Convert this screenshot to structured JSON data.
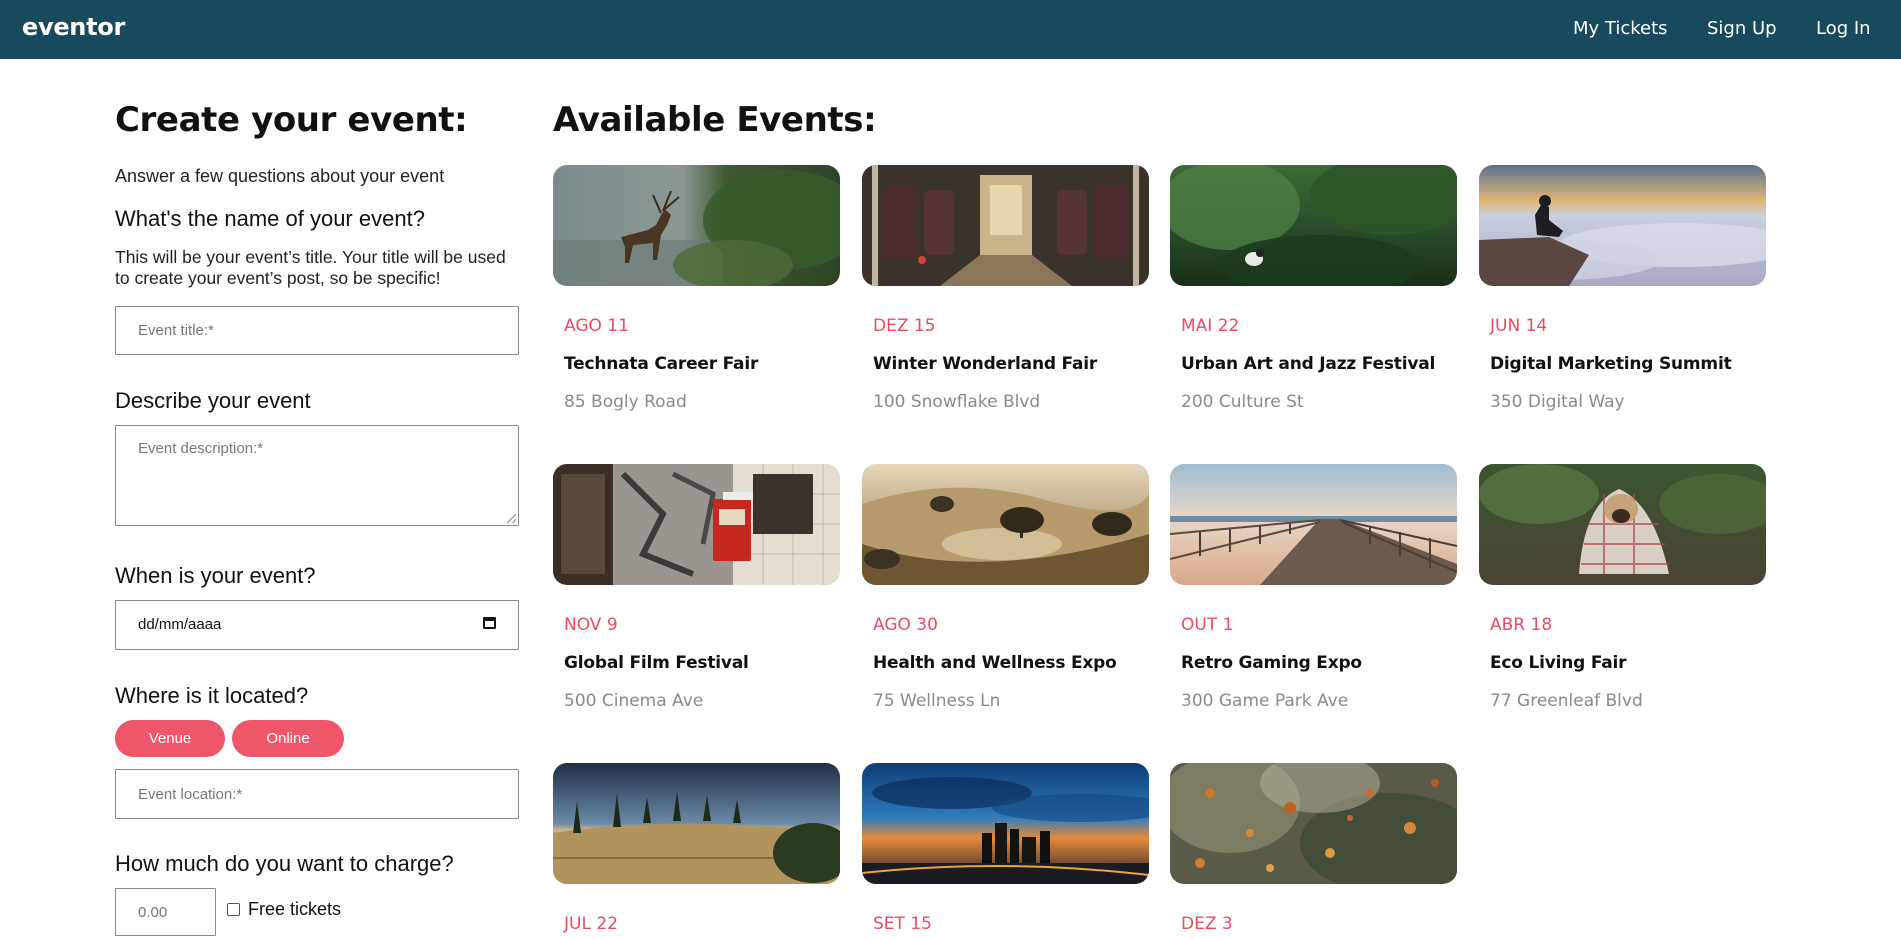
{
  "nav": {
    "brand": "eventor",
    "links": [
      "My Tickets",
      "Sign Up",
      "Log In"
    ]
  },
  "form": {
    "heading": "Create your event:",
    "intro": "Answer a few questions about your event",
    "name_question": "What's the name of your event?",
    "name_help": "This will be your event’s title. Your title will be used to create your event’s post, so be specific!",
    "title_placeholder": "Event title:*",
    "describe_question": "Describe your event",
    "description_placeholder": "Event description:*",
    "when_question": "When is your event?",
    "date_value": "dd/mm/aaaa",
    "where_question": "Where is it located?",
    "venue_label": "Venue",
    "online_label": "Online",
    "location_placeholder": "Event location:*",
    "charge_question": "How much do you want to charge?",
    "price_placeholder": "0.00",
    "free_label": "Free tickets"
  },
  "events": {
    "heading": "Available Events:",
    "items": [
      {
        "date": "AGO 11",
        "title": "Technata Career Fair",
        "address": "85 Bogly Road",
        "image": "deer-in-stream"
      },
      {
        "date": "DEZ 15",
        "title": "Winter Wonderland Fair",
        "address": "100 Snowflake Blvd",
        "image": "bus-interior"
      },
      {
        "date": "MAI 22",
        "title": "Urban Art and Jazz Festival",
        "address": "200 Culture St",
        "image": "forest-animal"
      },
      {
        "date": "JUN 14",
        "title": "Digital Marketing Summit",
        "address": "350 Digital Way",
        "image": "man-above-clouds"
      },
      {
        "date": "NOV 9",
        "title": "Global Film Festival",
        "address": "500 Cinema Ave",
        "image": "red-mailbox"
      },
      {
        "date": "AGO 30",
        "title": "Health and Wellness Expo",
        "address": "75 Wellness Ln",
        "image": "savanna-hills"
      },
      {
        "date": "OUT 1",
        "title": "Retro Gaming Expo",
        "address": "300 Game Park Ave",
        "image": "pier-beach"
      },
      {
        "date": "ABR 18",
        "title": "Eco Living Fair",
        "address": "77 Greenleaf Blvd",
        "image": "pug-in-blanket"
      },
      {
        "date": "JUL 22",
        "title": "",
        "address": "",
        "image": "cypress-hill"
      },
      {
        "date": "SET 15",
        "title": "",
        "address": "",
        "image": "city-skyline-sunset"
      },
      {
        "date": "DEZ 3",
        "title": "",
        "address": "",
        "image": "autumn-leaves"
      }
    ]
  },
  "colors": {
    "navbar": "#174a5c",
    "accent": "#f0566a",
    "date_text": "#e84c63",
    "muted_text": "#8a8a8a"
  }
}
